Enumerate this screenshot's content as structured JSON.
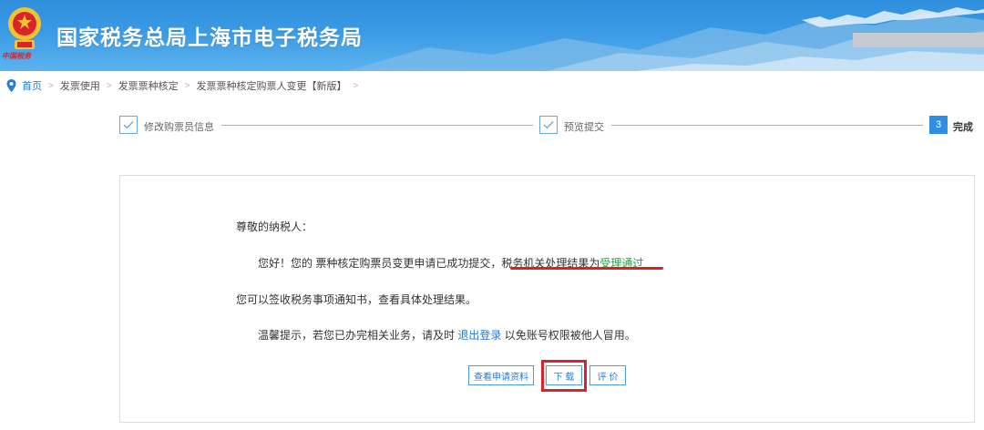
{
  "header": {
    "title": "国家税务总局上海市电子税务局",
    "emblem_text": "中国税务"
  },
  "breadcrumb": {
    "items": [
      "首页",
      "发票使用",
      "发票票种核定",
      "发票票种核定购票人变更【新版】"
    ]
  },
  "steps": [
    {
      "label": "修改购票员信息",
      "state": "done"
    },
    {
      "label": "预览提交",
      "state": "done"
    },
    {
      "number": "3",
      "label": "完成",
      "state": "current"
    }
  ],
  "message": {
    "greeting": "尊敬的纳税人：",
    "line1_prefix": "您好！您的 票种核定购票员变更申请已成功提交，税务机关处理结果为",
    "line1_status": "受理通过",
    "line2": "您可以签收税务事项通知书，查看具体处理结果。",
    "line3_prefix": "温馨提示，若您已办完相关业务，请及时",
    "line3_link": "退出登录",
    "line3_suffix": "以免账号权限被他人冒用。"
  },
  "buttons": {
    "view": "查看申请资料",
    "download": "下 载",
    "rate": "评 价"
  },
  "colors": {
    "brand_blue": "#2e8ee3",
    "success_green": "#1f9e3c",
    "highlight_red": "#d9232d"
  }
}
